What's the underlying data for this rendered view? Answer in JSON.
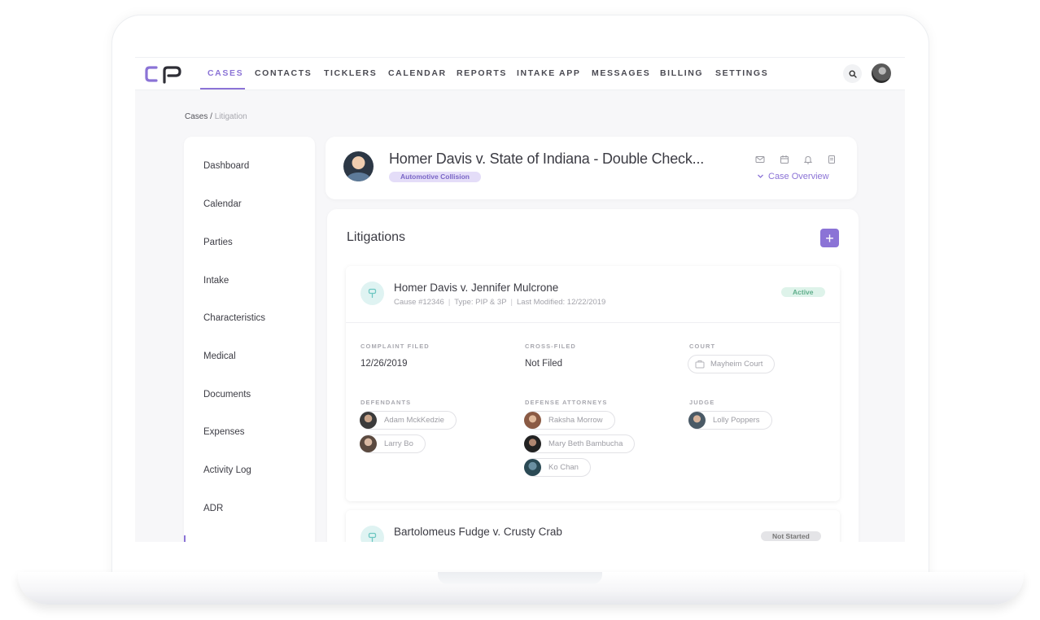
{
  "nav": {
    "items": [
      "CASES",
      "CONTACTS",
      "TICKLERS",
      "CALENDAR",
      "REPORTS",
      "INTAKE APP",
      "MESSAGES",
      "BILLING",
      "SETTINGS"
    ],
    "active": "CASES"
  },
  "breadcrumb": {
    "root": "Cases",
    "separator": " / ",
    "current": "Litigation"
  },
  "sidebar": {
    "items": [
      {
        "label": "Dashboard"
      },
      {
        "label": "Calendar"
      },
      {
        "label": "Parties"
      },
      {
        "label": "Intake"
      },
      {
        "label": "Characteristics"
      },
      {
        "label": "Medical"
      },
      {
        "label": "Documents"
      },
      {
        "label": "Expenses"
      },
      {
        "label": "Activity Log"
      },
      {
        "label": "ADR"
      }
    ]
  },
  "case": {
    "title": "Homer Davis v. State of Indiana - Double Check...",
    "tag": "Automotive Collision",
    "overview_label": "Case Overview"
  },
  "litigations": {
    "heading": "Litigations",
    "add_label": "+",
    "cards": [
      {
        "title": "Homer Davis v. Jennifer Mulcrone",
        "cause": "Cause #12346",
        "type": "Type: PIP & 3P",
        "modified": "Last Modified: 12/22/2019",
        "status": "Active",
        "complaint_filed_label": "COMPLAINT FILED",
        "complaint_filed": "12/26/2019",
        "cross_filed_label": "CROSS-FILED",
        "cross_filed": "Not Filed",
        "court_label": "COURT",
        "court": "Mayheim Court",
        "defendants_label": "DEFENDANTS",
        "defendants": [
          "Adam MckKedzie",
          "Larry Bo"
        ],
        "defense_attorneys_label": "DEFENSE ATTORNEYS",
        "defense_attorneys": [
          "Raksha Morrow",
          "Mary Beth Bambucha",
          "Ko Chan"
        ],
        "judge_label": "JUDGE",
        "judge": "Lolly Poppers"
      },
      {
        "title": "Bartolomeus Fudge v. Crusty Crab",
        "status": "Not Started"
      }
    ]
  },
  "colors": {
    "accent": "#8b73d6",
    "active_badge": "#5fae8b",
    "tag_bg": "#e4ddf8"
  },
  "icons": [
    "logo-icon",
    "search-icon",
    "mail-icon",
    "calendar-icon",
    "bell-icon",
    "document-icon",
    "chevron-down-icon",
    "plus-icon",
    "gavel-icon",
    "court-icon"
  ]
}
